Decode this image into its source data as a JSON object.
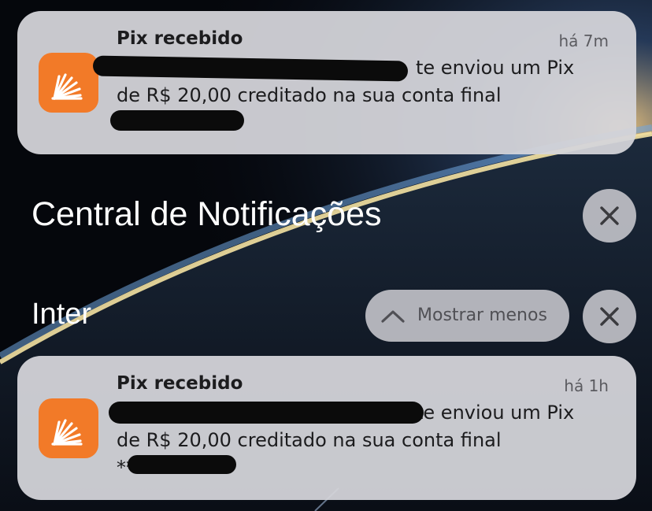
{
  "notifications": [
    {
      "icon": "inter-app-icon",
      "title": "Pix recebido",
      "time": "há 7m",
      "line1_visible_end": "te enviou um Pix",
      "line2": "de R$ 20,00 creditado na sua conta final"
    },
    {
      "icon": "inter-app-icon",
      "title": "Pix recebido",
      "time": "há 1h",
      "line1_visible_end": "te enviou um Pix",
      "line2": "de R$ 20,00 creditado na sua conta final",
      "line3_visible": "**"
    }
  ],
  "notification_center": {
    "title": "Central de Notificações",
    "close_icon": "close-icon"
  },
  "group": {
    "name": "Inter",
    "show_less_label": "Mostrar menos",
    "show_less_icon": "chevron-up-icon",
    "close_icon": "close-icon"
  },
  "colors": {
    "app_icon": "#f27a28",
    "card_bg": "#d5d5da",
    "redaction": "#0b0b0b"
  }
}
